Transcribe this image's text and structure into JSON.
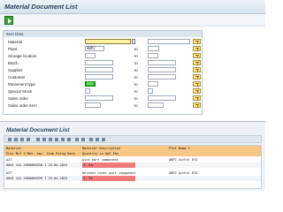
{
  "window": {
    "title": "Material Document List"
  },
  "toolbar": {
    "execute_button": "execute-icon"
  },
  "selection": {
    "group_title": "Item Data",
    "to_label": "to",
    "fields": [
      {
        "label": "Material",
        "from_value": "",
        "from_highlight": true
      },
      {
        "label": "Plant",
        "from_value": "ABP2"
      },
      {
        "label": "Storage location",
        "from_value": ""
      },
      {
        "label": "Batch",
        "from_value": ""
      },
      {
        "label": "Supplier",
        "from_value": ""
      },
      {
        "label": "Customer",
        "from_value": ""
      },
      {
        "label": "Movement type",
        "from_value": "241",
        "from_green": true
      },
      {
        "label": "Special Stock",
        "from_value": ""
      },
      {
        "label": "Sales order",
        "from_value": ""
      },
      {
        "label": "Sales order item",
        "from_value": ""
      }
    ]
  },
  "results": {
    "title": "Material Document List",
    "columns_line1": [
      "Material",
      "Material Description",
      "Plnt Name 1"
    ],
    "columns_line2": [
      "SLoc MvT S Mat. Doc.  Item Pstng Date",
      "Quantity in UnE EUn"
    ],
    "rows": [
      {
        "material": "AZT",
        "description": "pick part component",
        "plant": "ABP2 AirFel KYZ",
        "line2": "0001 241   4900000338   1  25.04.2023",
        "qty": "3- EA"
      },
      {
        "material": "AZT",
        "description": "Release cover part component",
        "plant": "ABP2 AirFel KYZ",
        "line2": "0001 241   4900000339   1  25.04.2023",
        "qty": "3- EA"
      }
    ]
  }
}
